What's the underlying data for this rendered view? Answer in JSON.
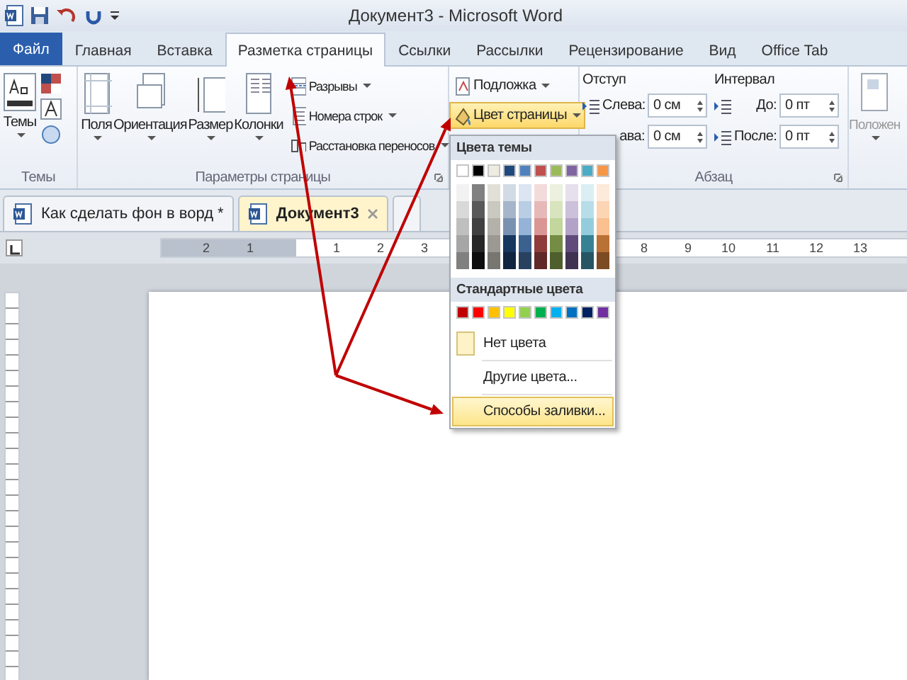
{
  "window": {
    "title": "Документ3 - Microsoft Word"
  },
  "ribbon_tabs": [
    {
      "label": "Файл",
      "kind": "file",
      "selected": false
    },
    {
      "label": "Главная",
      "kind": "tab",
      "selected": false
    },
    {
      "label": "Вставка",
      "kind": "tab",
      "selected": false
    },
    {
      "label": "Разметка страницы",
      "kind": "tab",
      "selected": true
    },
    {
      "label": "Ссылки",
      "kind": "tab",
      "selected": false
    },
    {
      "label": "Рассылки",
      "kind": "tab",
      "selected": false
    },
    {
      "label": "Рецензирование",
      "kind": "tab",
      "selected": false
    },
    {
      "label": "Вид",
      "kind": "tab",
      "selected": false
    },
    {
      "label": "Office Tab",
      "kind": "tab",
      "selected": false
    }
  ],
  "themes_group": {
    "label": "Темы",
    "button": "Темы"
  },
  "page_setup_group": {
    "label": "Параметры страницы",
    "large_buttons": [
      "Поля",
      "Ориентация",
      "Размер",
      "Колонки"
    ],
    "small_buttons": [
      "Разрывы",
      "Номера строк",
      "Расстановка переносов"
    ]
  },
  "page_background_group": {
    "buttons": [
      {
        "label": "Подложка",
        "selected": false
      },
      {
        "label": "Цвет страницы",
        "selected": true
      }
    ]
  },
  "paragraph_group": {
    "label": "Абзац",
    "indent": {
      "title": "Отступ",
      "fields": [
        {
          "label": "Слева:",
          "value": "0 см",
          "icon": true
        },
        {
          "label": "ава:",
          "value": "0 см",
          "icon": false
        }
      ]
    },
    "spacing": {
      "title": "Интервал",
      "fields": [
        {
          "label": "До:",
          "value": "0 пт",
          "icon": true
        },
        {
          "label": "После:",
          "value": "0 пт",
          "icon": true
        }
      ]
    }
  },
  "arrange_group": {
    "button": "Положен"
  },
  "document_tabs": [
    {
      "label": "Как сделать фон в ворд *",
      "selected": false,
      "closable": false
    },
    {
      "label": "Документ3",
      "selected": true,
      "closable": true
    }
  ],
  "ruler": {
    "left_labels": [
      "2",
      "1"
    ],
    "labels": [
      "1",
      "2",
      "3"
    ],
    "right_labels": [
      "8",
      "9",
      "10",
      "11",
      "12",
      "13"
    ]
  },
  "color_menu": {
    "theme_header": "Цвета темы",
    "theme_colors": [
      {
        "color": "#ffffff"
      },
      {
        "color": "#000000"
      },
      {
        "color": "#eeece1"
      },
      {
        "color": "#1f497d"
      },
      {
        "color": "#4f81bd"
      },
      {
        "color": "#c0504d"
      },
      {
        "color": "#9bbb59"
      },
      {
        "color": "#8064a2"
      },
      {
        "color": "#4bacc6"
      },
      {
        "color": "#f79646"
      }
    ],
    "standard_header": "Стандартные цвета",
    "standard_colors": [
      {
        "color": "#c00000"
      },
      {
        "color": "#ff0000"
      },
      {
        "color": "#ffc000"
      },
      {
        "color": "#ffff00"
      },
      {
        "color": "#92d050"
      },
      {
        "color": "#00b050"
      },
      {
        "color": "#00b0f0"
      },
      {
        "color": "#0070c0"
      },
      {
        "color": "#002060"
      },
      {
        "color": "#7030a0"
      }
    ],
    "items": [
      {
        "label": "Нет цвета",
        "kind": "swatch",
        "selected": false
      },
      {
        "label": "Другие цвета...",
        "kind": "plain",
        "selected": false
      },
      {
        "label": "Способы заливки...",
        "kind": "plain",
        "selected": true
      }
    ]
  }
}
